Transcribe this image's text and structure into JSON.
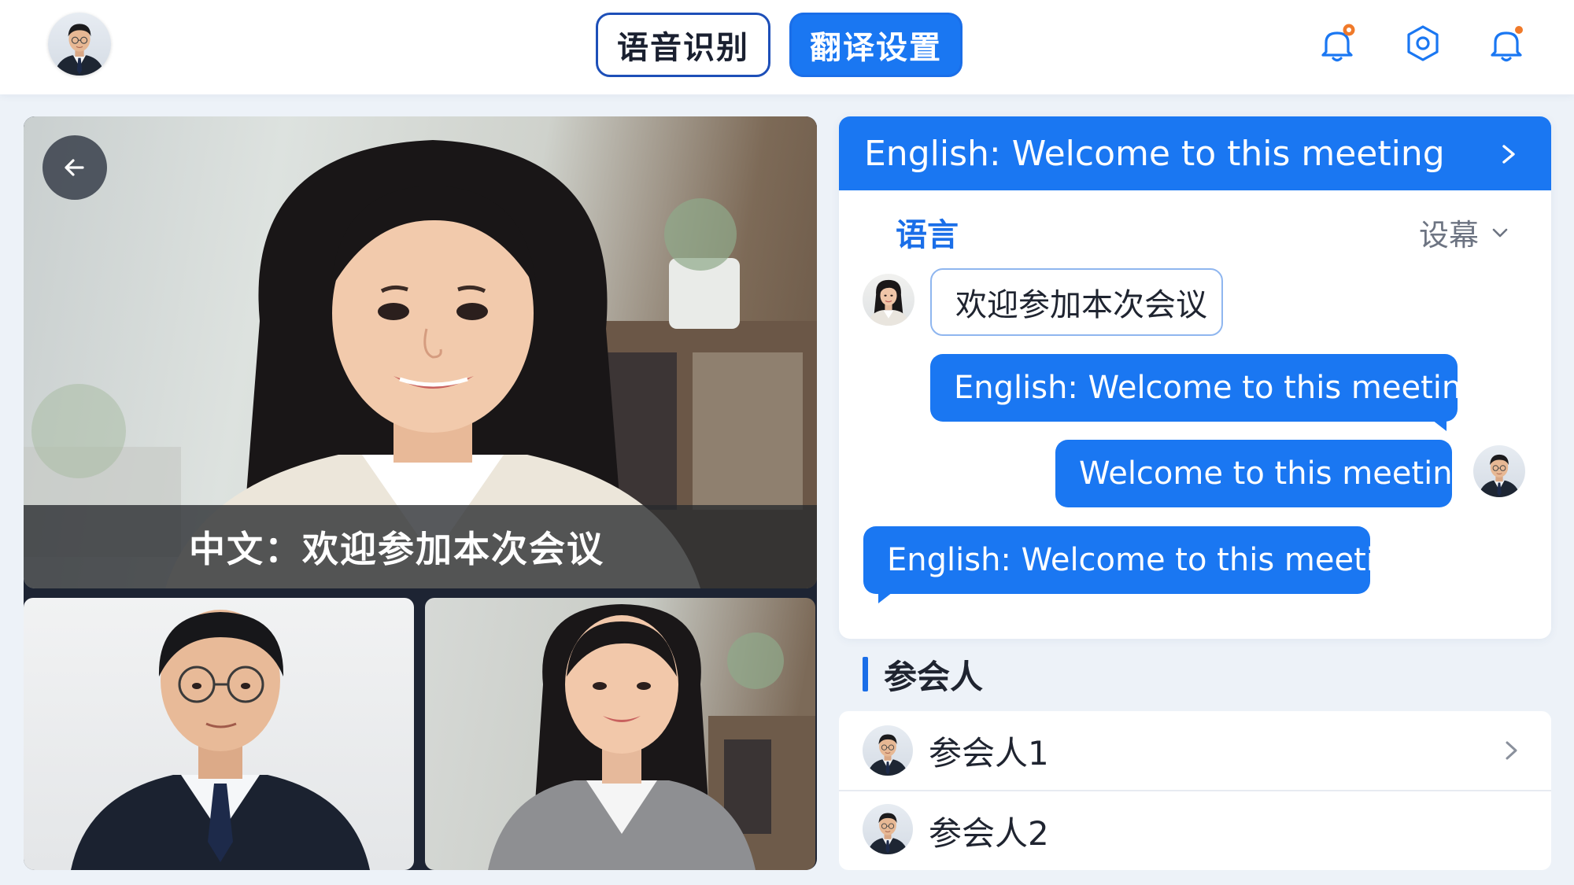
{
  "topbar": {
    "user_avatar": "user-avatar-man",
    "tabs": [
      {
        "label": "语音识别",
        "active": false
      },
      {
        "label": "翻译设置",
        "active": true
      }
    ],
    "icons": [
      "notification-bell-icon",
      "settings-gear-icon",
      "alert-bell-icon"
    ]
  },
  "video": {
    "caption": "中文：欢迎参加本次会议",
    "back_icon": "arrow-left-icon",
    "tiles": [
      "participant-man",
      "participant-woman"
    ]
  },
  "chat": {
    "header": "English: Welcome to this meeting",
    "language_label": "语言",
    "subtitle_select": "设幕",
    "messages": [
      {
        "text": "欢迎参加本次会议",
        "style": "outline",
        "side": "left"
      },
      {
        "text": "English: Welcome to this meeting",
        "style": "blue",
        "side": "left"
      },
      {
        "text": "Welcome to this meeting",
        "style": "blue",
        "side": "right"
      },
      {
        "text": "English: Welcome to this meeting",
        "style": "blue",
        "side": "left"
      }
    ]
  },
  "participants": {
    "title": "参会人",
    "items": [
      {
        "name": "参会人1"
      },
      {
        "name": "参会人2"
      }
    ]
  },
  "colors": {
    "accent": "#1a77f2",
    "accent_dark": "#1d4fb8",
    "badge": "#f07a2a",
    "background": "#edf2f8"
  }
}
